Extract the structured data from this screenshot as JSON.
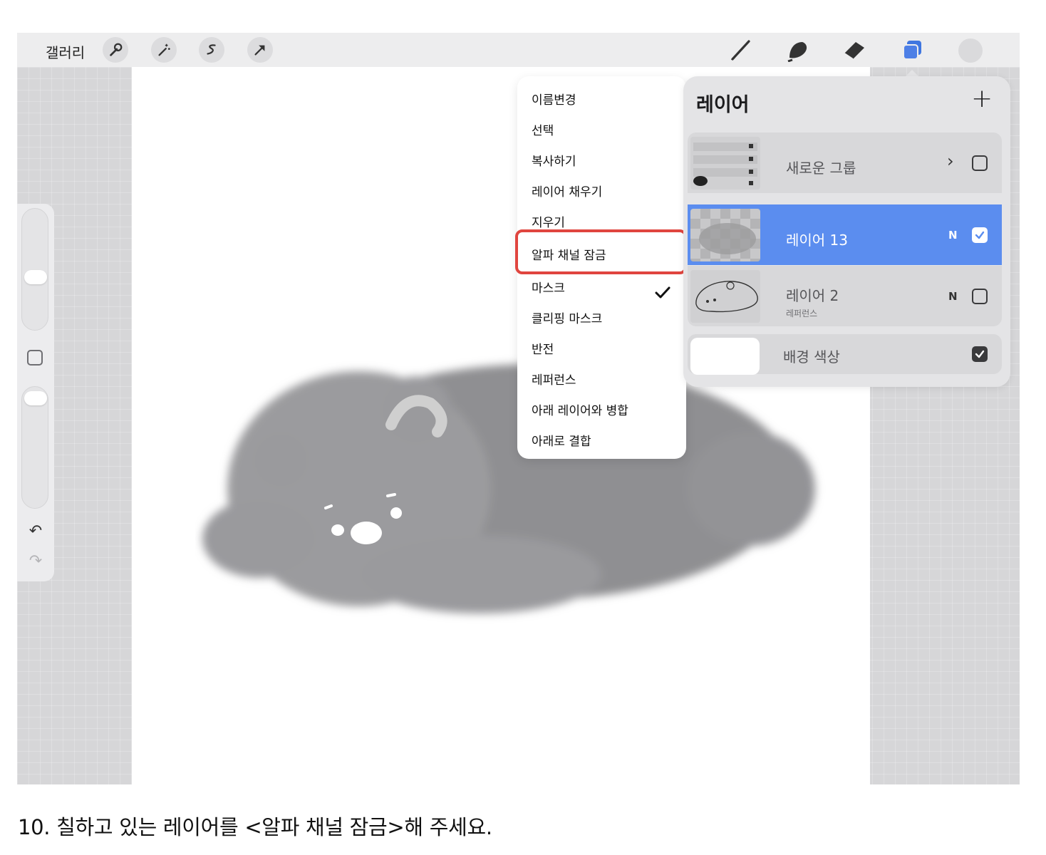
{
  "topbar": {
    "gallery_label": "갤러리",
    "left_tools": [
      "wrench-icon",
      "magic-wand-icon",
      "selection-icon",
      "transform-icon"
    ],
    "right_tools": [
      "brush-icon",
      "smudge-icon",
      "eraser-icon",
      "layers-icon"
    ],
    "accent_color": "#4d7fe6"
  },
  "sidebar": {
    "size_slider_level": 0.5,
    "opacity_slider_level": 0.0
  },
  "context_menu": {
    "items": [
      "이름변경",
      "선택",
      "복사하기",
      "레이어 채우기",
      "지우기",
      "알파 채널 잠금",
      "마스크",
      "클리핑 마스크",
      "반전",
      "레퍼런스",
      "아래 레이어와 병합",
      "아래로 결합"
    ],
    "checked_item": "알파 채널 잠금"
  },
  "layers_panel": {
    "title": "레이어",
    "add_label": "+",
    "layers": [
      {
        "name": "새로운 그룹",
        "blend": "",
        "checked": false
      },
      {
        "name": "레이어 13",
        "blend": "N",
        "checked": true,
        "selected": true
      },
      {
        "name": "레이어 2",
        "sub": "레퍼런스",
        "blend": "N",
        "checked": false
      }
    ],
    "background": {
      "name": "배경 색상",
      "checked": true
    },
    "selected_color": "#5b8def"
  },
  "caption": "10.  칠하고 있는 레이어를 <알파 채널 잠금>해 주세요."
}
